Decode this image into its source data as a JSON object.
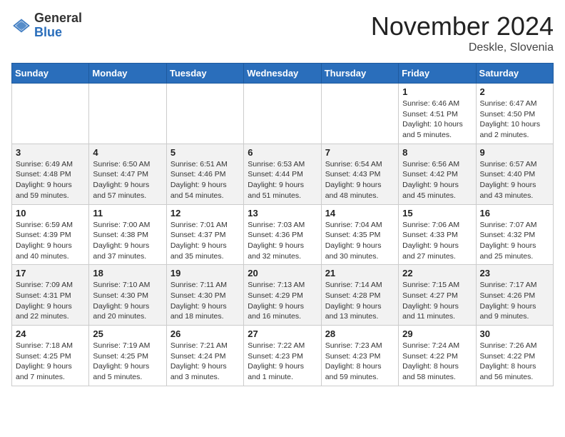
{
  "logo": {
    "general": "General",
    "blue": "Blue"
  },
  "header": {
    "month": "November 2024",
    "location": "Deskle, Slovenia"
  },
  "weekdays": [
    "Sunday",
    "Monday",
    "Tuesday",
    "Wednesday",
    "Thursday",
    "Friday",
    "Saturday"
  ],
  "weeks": [
    [
      {
        "day": "",
        "info": ""
      },
      {
        "day": "",
        "info": ""
      },
      {
        "day": "",
        "info": ""
      },
      {
        "day": "",
        "info": ""
      },
      {
        "day": "",
        "info": ""
      },
      {
        "day": "1",
        "info": "Sunrise: 6:46 AM\nSunset: 4:51 PM\nDaylight: 10 hours\nand 5 minutes."
      },
      {
        "day": "2",
        "info": "Sunrise: 6:47 AM\nSunset: 4:50 PM\nDaylight: 10 hours\nand 2 minutes."
      }
    ],
    [
      {
        "day": "3",
        "info": "Sunrise: 6:49 AM\nSunset: 4:48 PM\nDaylight: 9 hours\nand 59 minutes."
      },
      {
        "day": "4",
        "info": "Sunrise: 6:50 AM\nSunset: 4:47 PM\nDaylight: 9 hours\nand 57 minutes."
      },
      {
        "day": "5",
        "info": "Sunrise: 6:51 AM\nSunset: 4:46 PM\nDaylight: 9 hours\nand 54 minutes."
      },
      {
        "day": "6",
        "info": "Sunrise: 6:53 AM\nSunset: 4:44 PM\nDaylight: 9 hours\nand 51 minutes."
      },
      {
        "day": "7",
        "info": "Sunrise: 6:54 AM\nSunset: 4:43 PM\nDaylight: 9 hours\nand 48 minutes."
      },
      {
        "day": "8",
        "info": "Sunrise: 6:56 AM\nSunset: 4:42 PM\nDaylight: 9 hours\nand 45 minutes."
      },
      {
        "day": "9",
        "info": "Sunrise: 6:57 AM\nSunset: 4:40 PM\nDaylight: 9 hours\nand 43 minutes."
      }
    ],
    [
      {
        "day": "10",
        "info": "Sunrise: 6:59 AM\nSunset: 4:39 PM\nDaylight: 9 hours\nand 40 minutes."
      },
      {
        "day": "11",
        "info": "Sunrise: 7:00 AM\nSunset: 4:38 PM\nDaylight: 9 hours\nand 37 minutes."
      },
      {
        "day": "12",
        "info": "Sunrise: 7:01 AM\nSunset: 4:37 PM\nDaylight: 9 hours\nand 35 minutes."
      },
      {
        "day": "13",
        "info": "Sunrise: 7:03 AM\nSunset: 4:36 PM\nDaylight: 9 hours\nand 32 minutes."
      },
      {
        "day": "14",
        "info": "Sunrise: 7:04 AM\nSunset: 4:35 PM\nDaylight: 9 hours\nand 30 minutes."
      },
      {
        "day": "15",
        "info": "Sunrise: 7:06 AM\nSunset: 4:33 PM\nDaylight: 9 hours\nand 27 minutes."
      },
      {
        "day": "16",
        "info": "Sunrise: 7:07 AM\nSunset: 4:32 PM\nDaylight: 9 hours\nand 25 minutes."
      }
    ],
    [
      {
        "day": "17",
        "info": "Sunrise: 7:09 AM\nSunset: 4:31 PM\nDaylight: 9 hours\nand 22 minutes."
      },
      {
        "day": "18",
        "info": "Sunrise: 7:10 AM\nSunset: 4:30 PM\nDaylight: 9 hours\nand 20 minutes."
      },
      {
        "day": "19",
        "info": "Sunrise: 7:11 AM\nSunset: 4:30 PM\nDaylight: 9 hours\nand 18 minutes."
      },
      {
        "day": "20",
        "info": "Sunrise: 7:13 AM\nSunset: 4:29 PM\nDaylight: 9 hours\nand 16 minutes."
      },
      {
        "day": "21",
        "info": "Sunrise: 7:14 AM\nSunset: 4:28 PM\nDaylight: 9 hours\nand 13 minutes."
      },
      {
        "day": "22",
        "info": "Sunrise: 7:15 AM\nSunset: 4:27 PM\nDaylight: 9 hours\nand 11 minutes."
      },
      {
        "day": "23",
        "info": "Sunrise: 7:17 AM\nSunset: 4:26 PM\nDaylight: 9 hours\nand 9 minutes."
      }
    ],
    [
      {
        "day": "24",
        "info": "Sunrise: 7:18 AM\nSunset: 4:25 PM\nDaylight: 9 hours\nand 7 minutes."
      },
      {
        "day": "25",
        "info": "Sunrise: 7:19 AM\nSunset: 4:25 PM\nDaylight: 9 hours\nand 5 minutes."
      },
      {
        "day": "26",
        "info": "Sunrise: 7:21 AM\nSunset: 4:24 PM\nDaylight: 9 hours\nand 3 minutes."
      },
      {
        "day": "27",
        "info": "Sunrise: 7:22 AM\nSunset: 4:23 PM\nDaylight: 9 hours\nand 1 minute."
      },
      {
        "day": "28",
        "info": "Sunrise: 7:23 AM\nSunset: 4:23 PM\nDaylight: 8 hours\nand 59 minutes."
      },
      {
        "day": "29",
        "info": "Sunrise: 7:24 AM\nSunset: 4:22 PM\nDaylight: 8 hours\nand 58 minutes."
      },
      {
        "day": "30",
        "info": "Sunrise: 7:26 AM\nSunset: 4:22 PM\nDaylight: 8 hours\nand 56 minutes."
      }
    ]
  ]
}
